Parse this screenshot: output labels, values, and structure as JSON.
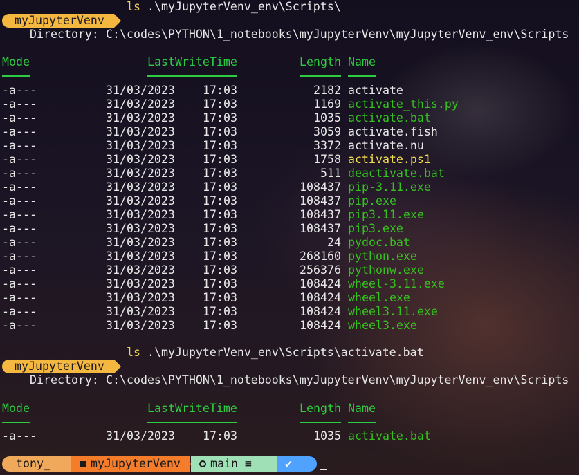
{
  "prompt": {
    "venv_label": "myJupyterVenv",
    "command_1": "ls",
    "args_1": ".\\myJupyterVenv_env\\Scripts\\",
    "command_2": "ls",
    "args_2": ".\\myJupyterVenv_env\\Scripts\\activate.bat"
  },
  "listing_1": {
    "directory_label": "Directory:",
    "directory_path": "C:\\codes\\PYTHON\\1_notebooks\\myJupyterVenv\\myJupyterVenv_env\\Scripts",
    "headers": {
      "mode": "Mode",
      "lastwrite": "LastWriteTime",
      "length": "Length",
      "name": "Name"
    },
    "rows": [
      {
        "mode": "-a---",
        "date": "31/03/2023",
        "time": "17:03",
        "length": "2182",
        "name": "activate",
        "color": "w"
      },
      {
        "mode": "-a---",
        "date": "31/03/2023",
        "time": "17:03",
        "length": "1169",
        "name": "activate_this.py",
        "color": "g"
      },
      {
        "mode": "-a---",
        "date": "31/03/2023",
        "time": "17:03",
        "length": "1035",
        "name": "activate.bat",
        "color": "g"
      },
      {
        "mode": "-a---",
        "date": "31/03/2023",
        "time": "17:03",
        "length": "3059",
        "name": "activate.fish",
        "color": "w"
      },
      {
        "mode": "-a---",
        "date": "31/03/2023",
        "time": "17:03",
        "length": "3372",
        "name": "activate.nu",
        "color": "w"
      },
      {
        "mode": "-a---",
        "date": "31/03/2023",
        "time": "17:03",
        "length": "1758",
        "name": "activate.ps1",
        "color": "y"
      },
      {
        "mode": "-a---",
        "date": "31/03/2023",
        "time": "17:03",
        "length": "511",
        "name": "deactivate.bat",
        "color": "g"
      },
      {
        "mode": "-a---",
        "date": "31/03/2023",
        "time": "17:03",
        "length": "108437",
        "name": "pip-3.11.exe",
        "color": "g"
      },
      {
        "mode": "-a---",
        "date": "31/03/2023",
        "time": "17:03",
        "length": "108437",
        "name": "pip.exe",
        "color": "g"
      },
      {
        "mode": "-a---",
        "date": "31/03/2023",
        "time": "17:03",
        "length": "108437",
        "name": "pip3.11.exe",
        "color": "g"
      },
      {
        "mode": "-a---",
        "date": "31/03/2023",
        "time": "17:03",
        "length": "108437",
        "name": "pip3.exe",
        "color": "g"
      },
      {
        "mode": "-a---",
        "date": "31/03/2023",
        "time": "17:03",
        "length": "24",
        "name": "pydoc.bat",
        "color": "g"
      },
      {
        "mode": "-a---",
        "date": "31/03/2023",
        "time": "17:03",
        "length": "268160",
        "name": "python.exe",
        "color": "g"
      },
      {
        "mode": "-a---",
        "date": "31/03/2023",
        "time": "17:03",
        "length": "256376",
        "name": "pythonw.exe",
        "color": "g"
      },
      {
        "mode": "-a---",
        "date": "31/03/2023",
        "time": "17:03",
        "length": "108424",
        "name": "wheel-3.11.exe",
        "color": "g"
      },
      {
        "mode": "-a---",
        "date": "31/03/2023",
        "time": "17:03",
        "length": "108424",
        "name": "wheel.exe",
        "color": "g"
      },
      {
        "mode": "-a---",
        "date": "31/03/2023",
        "time": "17:03",
        "length": "108424",
        "name": "wheel3.11.exe",
        "color": "g"
      },
      {
        "mode": "-a---",
        "date": "31/03/2023",
        "time": "17:03",
        "length": "108424",
        "name": "wheel3.exe",
        "color": "g"
      }
    ]
  },
  "listing_2": {
    "directory_label": "Directory:",
    "directory_path": "C:\\codes\\PYTHON\\1_notebooks\\myJupyterVenv\\myJupyterVenv_env\\Scripts",
    "headers": {
      "mode": "Mode",
      "lastwrite": "LastWriteTime",
      "length": "Length",
      "name": "Name"
    },
    "rows": [
      {
        "mode": "-a---",
        "date": "31/03/2023",
        "time": "17:03",
        "length": "1035",
        "name": "activate.bat",
        "color": "g"
      }
    ]
  },
  "statusline": {
    "user": "tony_",
    "folder_icon": "folder-icon",
    "folder": "myJupyterVenv",
    "git_icon": "git-icon",
    "branch": "main",
    "branch_status": "≡",
    "ok_icon": "check-icon",
    "ok_glyph": "✔"
  },
  "colors": {
    "prompt_pill": "#f4b740",
    "header_green": "#2ecc40",
    "file_green": "#36c21e",
    "ps1_yellow": "#f4e04d"
  }
}
